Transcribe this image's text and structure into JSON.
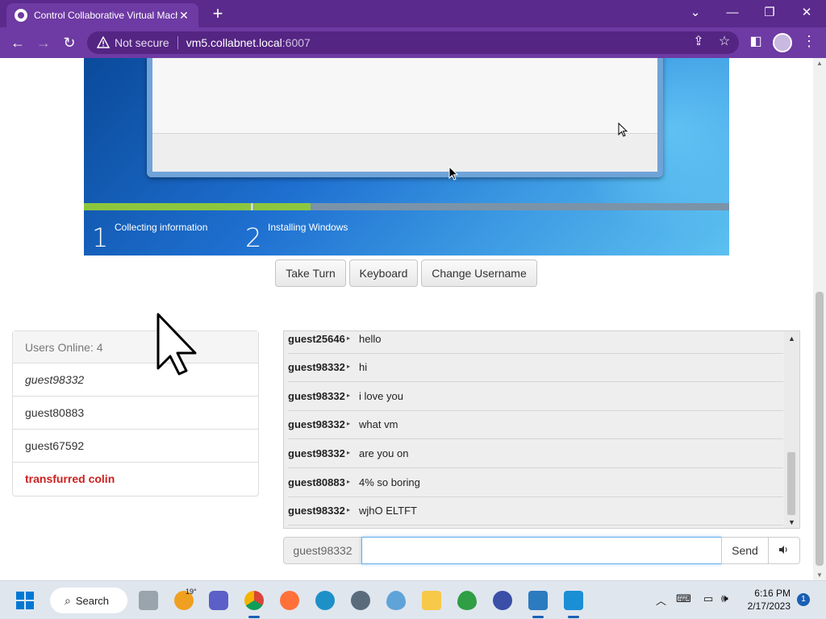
{
  "browser": {
    "tab_title": "Control Collaborative Virtual Machines",
    "security_label": "Not secure",
    "url_host": "vm5.collabnet.local",
    "url_port": ":6007"
  },
  "vm": {
    "setup_steps": [
      {
        "num": "1",
        "label": "Collecting information"
      },
      {
        "num": "2",
        "label": "Installing Windows"
      }
    ],
    "install_progress": 0.35
  },
  "controls": {
    "take_turn": "Take Turn",
    "keyboard": "Keyboard",
    "change_username": "Change Username"
  },
  "users": {
    "header": "Users Online: 4",
    "list": [
      {
        "name": "guest98332"
      },
      {
        "name": "guest80883"
      },
      {
        "name": "guest67592"
      },
      {
        "name": "transfurred colin"
      }
    ]
  },
  "chat": {
    "messages": [
      {
        "user": "guest25646",
        "text": "hello"
      },
      {
        "user": "guest98332",
        "text": "hi"
      },
      {
        "user": "guest98332",
        "text": "i love you"
      },
      {
        "user": "guest98332",
        "text": "what vm"
      },
      {
        "user": "guest98332",
        "text": "are you on"
      },
      {
        "user": "guest80883",
        "text": "4% so boring"
      },
      {
        "user": "guest98332",
        "text": "wjhO ELTFT"
      }
    ],
    "input_prefix": "guest98332",
    "input_value": "",
    "send_label": "Send"
  },
  "taskbar": {
    "search_label": "Search",
    "weather_temp": "19°",
    "time": "6:16 PM",
    "date": "2/17/2023",
    "notification_count": "1"
  }
}
